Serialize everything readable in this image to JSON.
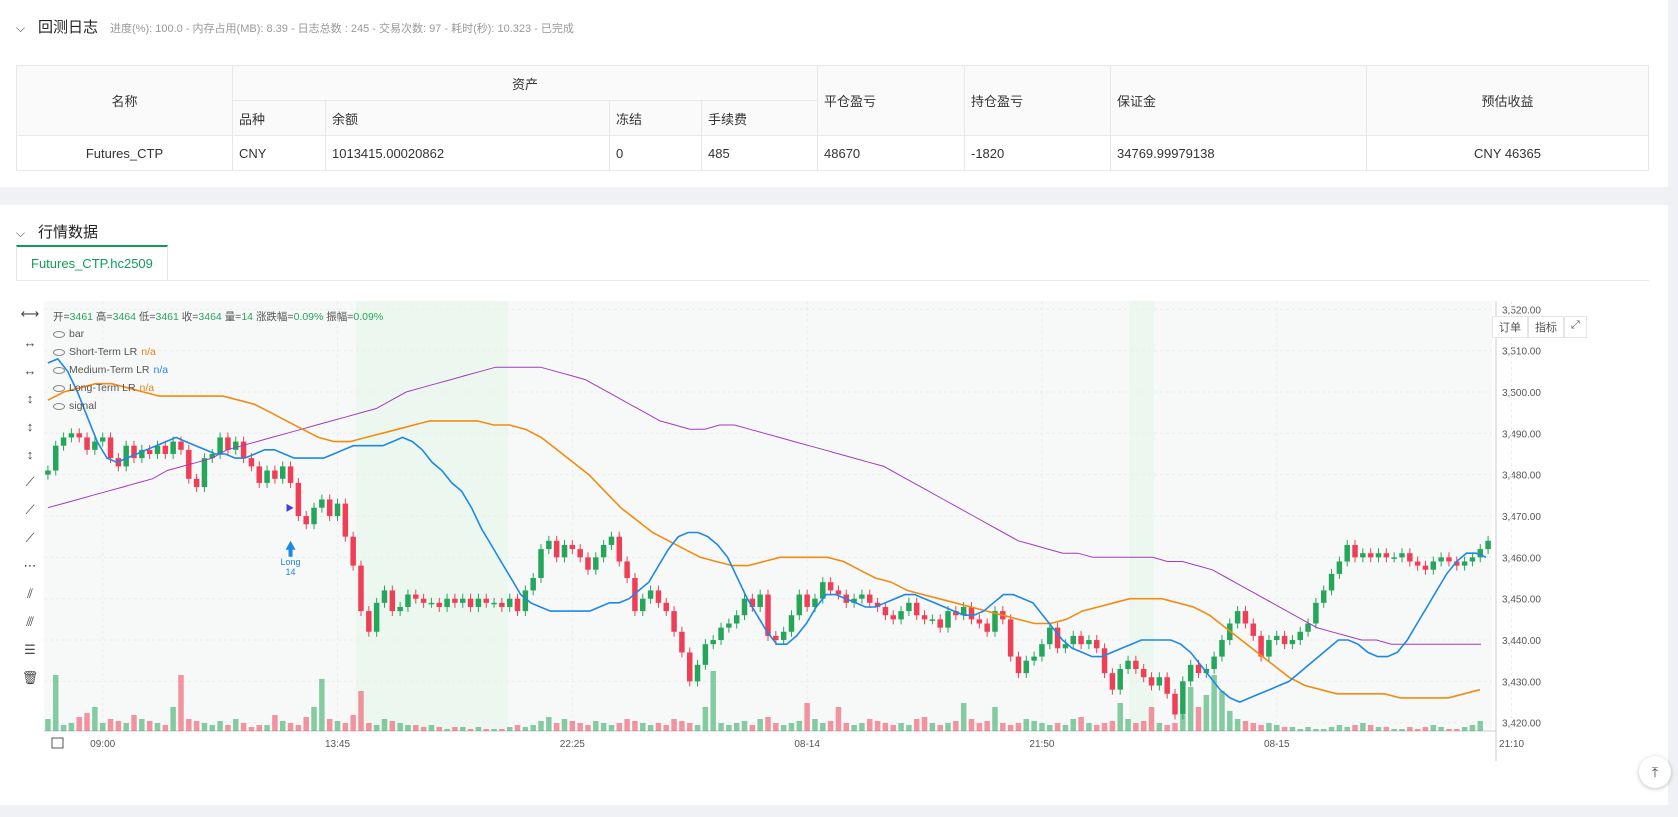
{
  "log": {
    "title": "回测日志",
    "summary": "进度(%): 100.0  -  内存占用(MB): 8.39  -  日志总数 : 245  -  交易次数:  97  -  耗时(秒): 10.323  -  已完成"
  },
  "assets_table": {
    "h_name": "名称",
    "h_assets": "资产",
    "h_close_pnl": "平仓盈亏",
    "h_pos_pnl": "持仓盈亏",
    "h_margin": "保证金",
    "h_est": "预估收益",
    "h_symbol": "品种",
    "h_balance": "余额",
    "h_frozen": "冻结",
    "h_fee": "手续费",
    "row": {
      "name": "Futures_CTP",
      "symbol": "CNY",
      "balance": "1013415.00020862",
      "frozen": "0",
      "fee": "485",
      "close_pnl": "48670",
      "pos_pnl": "-1820",
      "margin": "34769.99979138",
      "est": "CNY 46365"
    }
  },
  "market": {
    "title": "行情数据",
    "tab": "Futures_CTP.hc2509",
    "ohlc": {
      "o_lbl": "开=",
      "o": "3461",
      "h_lbl": "高=",
      "h": "3464",
      "l_lbl": "低=",
      "l": "3461",
      "c_lbl": "收=",
      "c": "3464",
      "v_lbl": "量=",
      "v": "14",
      "chg_lbl": "涨跌幅=",
      "chg": "0.09%",
      "amp_lbl": "振幅=",
      "amp": "0.09%"
    },
    "legend": {
      "bar": "bar",
      "short": "Short-Term LR",
      "medium": "Medium-Term LR",
      "long": "Long-Term LR",
      "signal": "signal",
      "na": "n/a"
    },
    "buttons": {
      "order": "订单",
      "indicator": "指标"
    },
    "signal_label": "Long",
    "signal_qty": "14"
  },
  "chart_data": {
    "type": "candlestick",
    "ylim": [
      3418,
      3522
    ],
    "y_ticks": [
      "3,420.00",
      "3,430.00",
      "3,440.00",
      "3,450.00",
      "3,460.00",
      "3,470.00",
      "3,480.00",
      "3,490.00",
      "3,500.00",
      "3,510.00",
      "3,520.00"
    ],
    "y_tick_values": [
      3420,
      3430,
      3440,
      3450,
      3460,
      3470,
      3480,
      3490,
      3500,
      3510,
      3520
    ],
    "x_ticks": [
      {
        "label": "09:00",
        "idx": 7
      },
      {
        "label": "13:45",
        "idx": 37
      },
      {
        "label": "22:25",
        "idx": 67
      },
      {
        "label": "08-14",
        "idx": 97
      },
      {
        "label": "21:50",
        "idx": 127
      },
      {
        "label": "08-15",
        "idx": 157
      },
      {
        "label": "21:10",
        "idx": 187
      }
    ],
    "closes": [
      3481,
      3487,
      3489,
      3490,
      3489,
      3486,
      3488,
      3489,
      3484,
      3482,
      3487,
      3484,
      3486,
      3485,
      3487,
      3485,
      3488,
      3486,
      3479,
      3477,
      3484,
      3485,
      3489,
      3486,
      3488,
      3484,
      3482,
      3478,
      3481,
      3479,
      3482,
      3478,
      3470,
      3468,
      3472,
      3474,
      3470,
      3473,
      3465,
      3458,
      3447,
      3442,
      3449,
      3452,
      3447,
      3448,
      3451,
      3450,
      3449,
      3449,
      3448,
      3450,
      3449,
      3450,
      3448,
      3450,
      3449,
      3449,
      3448,
      3450,
      3447,
      3452,
      3455,
      3462,
      3464,
      3460,
      3463,
      3462,
      3460,
      3457,
      3460,
      3463,
      3465,
      3459,
      3455,
      3447,
      3450,
      3452,
      3449,
      3447,
      3442,
      3437,
      3430,
      3434,
      3439,
      3440,
      3443,
      3444,
      3446,
      3450,
      3448,
      3451,
      3441,
      3440,
      3442,
      3446,
      3451,
      3448,
      3450,
      3454,
      3452,
      3451,
      3449,
      3450,
      3451,
      3449,
      3448,
      3446,
      3445,
      3447,
      3449,
      3446,
      3445,
      3445,
      3443,
      3447,
      3446,
      3448,
      3445,
      3444,
      3442,
      3447,
      3445,
      3436,
      3432,
      3435,
      3436,
      3439,
      3443,
      3438,
      3439,
      3441,
      3439,
      3440,
      3438,
      3432,
      3428,
      3433,
      3435,
      3433,
      3431,
      3429,
      3431,
      3427,
      3422,
      3430,
      3434,
      3432,
      3433,
      3436,
      3440,
      3444,
      3447,
      3444,
      3441,
      3436,
      3440,
      3441,
      3439,
      3440,
      3442,
      3444,
      3449,
      3452,
      3456,
      3459,
      3463,
      3460,
      3461,
      3460,
      3461,
      3460,
      3460,
      3461,
      3459,
      3458,
      3457,
      3459,
      3460,
      3459,
      3458,
      3459,
      3460,
      3462,
      3464
    ],
    "volume": [
      6,
      28,
      3,
      4,
      7,
      9,
      12,
      4,
      6,
      5,
      4,
      8,
      6,
      5,
      4,
      3,
      12,
      28,
      6,
      5,
      4,
      3,
      5,
      3,
      6,
      4,
      2,
      3,
      3,
      8,
      5,
      4,
      3,
      7,
      12,
      26,
      6,
      5,
      4,
      8,
      20,
      4,
      3,
      6,
      5,
      4,
      3,
      3,
      2,
      3,
      2,
      1,
      2,
      2,
      1,
      2,
      1,
      1,
      1,
      2,
      3,
      2,
      3,
      5,
      7,
      4,
      6,
      5,
      4,
      3,
      5,
      4,
      3,
      4,
      6,
      5,
      4,
      3,
      4,
      3,
      6,
      5,
      4,
      3,
      12,
      30,
      4,
      3,
      4,
      5,
      3,
      6,
      7,
      4,
      3,
      4,
      5,
      14,
      6,
      4,
      5,
      12,
      4,
      3,
      4,
      6,
      5,
      4,
      3,
      4,
      3,
      6,
      7,
      4,
      3,
      4,
      5,
      14,
      6,
      4,
      5,
      12,
      4,
      3,
      4,
      6,
      5,
      4,
      3,
      4,
      3,
      6,
      7,
      4,
      3,
      4,
      5,
      14,
      6,
      4,
      5,
      12,
      4,
      3,
      4,
      8,
      22,
      12,
      18,
      28,
      20,
      10,
      6,
      5,
      4,
      3,
      4,
      3,
      2,
      2,
      1,
      2,
      1,
      1,
      2,
      3,
      2,
      3,
      4,
      3,
      2,
      2,
      1,
      1,
      2,
      1,
      2,
      3,
      2,
      1,
      1,
      2,
      3,
      5
    ],
    "short_lr": [
      3507,
      3508,
      3505,
      3500,
      3494,
      3488,
      3484,
      3483,
      3484,
      3485,
      3486,
      3487,
      3488,
      3489,
      3488,
      3487,
      3486,
      3485,
      3485,
      3484,
      3484,
      3485,
      3486,
      3486,
      3485,
      3484,
      3484,
      3484,
      3484,
      3485,
      3486,
      3487,
      3487,
      3487,
      3487,
      3488,
      3489,
      3488,
      3486,
      3483,
      3481,
      3478,
      3476,
      3472,
      3467,
      3463,
      3459,
      3455,
      3451,
      3449,
      3448,
      3447,
      3447,
      3447,
      3447,
      3447,
      3448,
      3449,
      3449,
      3450,
      3452,
      3454,
      3458,
      3462,
      3465,
      3466,
      3466,
      3465,
      3463,
      3460,
      3455,
      3450,
      3446,
      3442,
      3439,
      3439,
      3441,
      3444,
      3448,
      3451,
      3451,
      3450,
      3449,
      3448,
      3448,
      3449,
      3450,
      3451,
      3451,
      3450,
      3449,
      3448,
      3447,
      3446,
      3446,
      3447,
      3449,
      3451,
      3451,
      3450,
      3449,
      3446,
      3443,
      3440,
      3438,
      3437,
      3436,
      3436,
      3437,
      3438,
      3439,
      3440,
      3440,
      3440,
      3440,
      3439,
      3437,
      3434,
      3431,
      3428,
      3426,
      3425,
      3426,
      3427,
      3428,
      3429,
      3430,
      3432,
      3434,
      3436,
      3438,
      3440,
      3440,
      3439,
      3437,
      3436,
      3436,
      3437,
      3440,
      3444,
      3448,
      3452,
      3456,
      3459,
      3461,
      3461,
      3460
    ],
    "medium_lr": [
      3498,
      3500,
      3501,
      3502,
      3502,
      3501,
      3500,
      3499,
      3499,
      3499,
      3499,
      3499,
      3498,
      3497,
      3495,
      3493,
      3491,
      3489,
      3488,
      3488,
      3489,
      3490,
      3491,
      3492,
      3493,
      3493,
      3493,
      3493,
      3492,
      3492,
      3491,
      3489,
      3486,
      3483,
      3480,
      3476,
      3472,
      3469,
      3466,
      3464,
      3462,
      3460,
      3459,
      3458,
      3458,
      3459,
      3460,
      3460,
      3460,
      3460,
      3459,
      3457,
      3455,
      3454,
      3452,
      3451,
      3450,
      3449,
      3448,
      3447,
      3446,
      3445,
      3444,
      3444,
      3445,
      3447,
      3448,
      3449,
      3450,
      3450,
      3450,
      3449,
      3448,
      3446,
      3443,
      3440,
      3437,
      3434,
      3431,
      3429,
      3428,
      3427,
      3427,
      3427,
      3427,
      3426,
      3426,
      3426,
      3426,
      3427,
      3428
    ],
    "long_lr": [
      3472,
      3473,
      3474,
      3475,
      3476,
      3477,
      3478,
      3479,
      3481,
      3482,
      3483,
      3484,
      3486,
      3487,
      3488,
      3489,
      3490,
      3491,
      3492,
      3493,
      3494,
      3495,
      3496,
      3498,
      3500,
      3501,
      3502,
      3503,
      3504,
      3505,
      3506,
      3506,
      3506,
      3506,
      3505,
      3504,
      3503,
      3501,
      3499,
      3497,
      3495,
      3493,
      3492,
      3491,
      3491,
      3492,
      3492,
      3491,
      3490,
      3489,
      3488,
      3487,
      3486,
      3485,
      3484,
      3483,
      3482,
      3480,
      3478,
      3476,
      3474,
      3472,
      3470,
      3468,
      3466,
      3464,
      3463,
      3462,
      3461,
      3461,
      3460,
      3460,
      3460,
      3460,
      3460,
      3459,
      3459,
      3458,
      3457,
      3455,
      3453,
      3451,
      3449,
      3447,
      3445,
      3443,
      3442,
      3441,
      3440,
      3440,
      3439,
      3439,
      3439,
      3439,
      3439,
      3439,
      3439
    ],
    "colors": {
      "up": "#26a65b",
      "down": "#ef3f57",
      "short": "#1e88e5",
      "short_light": "#7fb8ea",
      "medium": "#f38b10",
      "medium_light": "#f8c07a",
      "long": "#a23bbd"
    }
  }
}
